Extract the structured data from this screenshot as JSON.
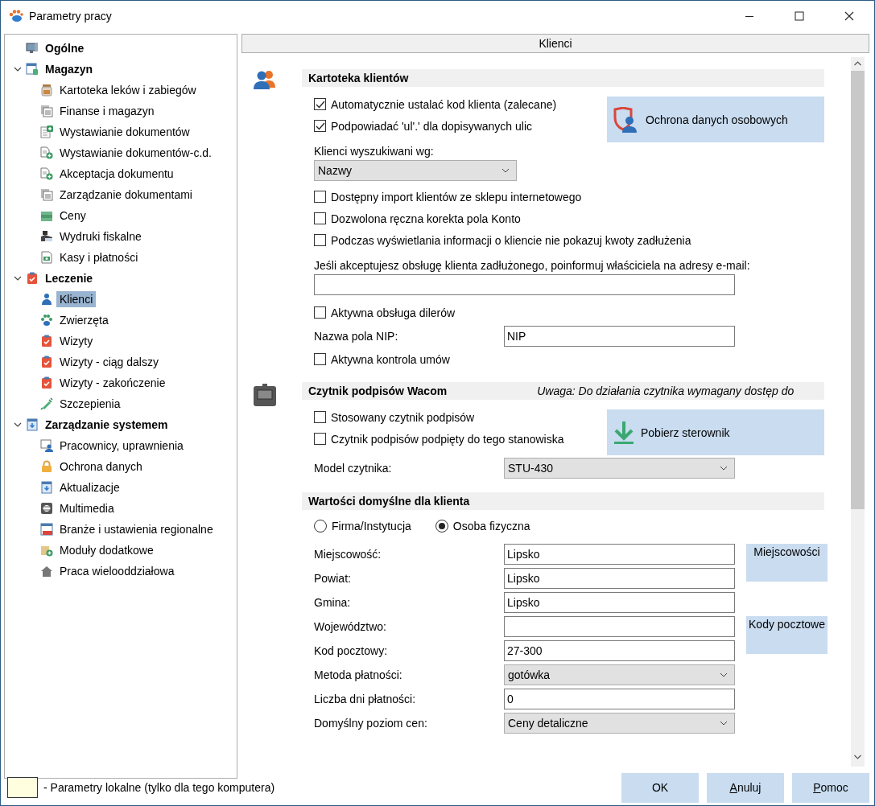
{
  "window": {
    "title": "Parametry pracy"
  },
  "tree": [
    {
      "label": "Ogólne",
      "kind": "monitor",
      "selected": false
    },
    {
      "label": "Magazyn",
      "kind": "form",
      "expanded": true,
      "selected": false,
      "children": [
        {
          "label": "Kartoteka leków i zabiegów",
          "kind": "jar",
          "selected": false
        },
        {
          "label": "Finanse i magazyn",
          "kind": "docs",
          "selected": false
        },
        {
          "label": "Wystawianie dokumentów",
          "kind": "doc-plus",
          "selected": false
        },
        {
          "label": "Wystawianie dokumentów-c.d.",
          "kind": "doc-add",
          "selected": false
        },
        {
          "label": "Akceptacja dokumentu",
          "kind": "doc-add",
          "selected": false
        },
        {
          "label": "Zarządzanie dokumentami",
          "kind": "docs",
          "selected": false
        },
        {
          "label": "Ceny",
          "kind": "money",
          "selected": false
        },
        {
          "label": "Wydruki fiskalne",
          "kind": "printer",
          "selected": false
        },
        {
          "label": "Kasy i płatności",
          "kind": "cash",
          "selected": false
        }
      ]
    },
    {
      "label": "Leczenie",
      "kind": "clipboard",
      "expanded": true,
      "selected": false,
      "children": [
        {
          "label": "Klienci",
          "kind": "person",
          "selected": true
        },
        {
          "label": "Zwierzęta",
          "kind": "paw",
          "selected": false
        },
        {
          "label": "Wizyty",
          "kind": "clipboard",
          "selected": false
        },
        {
          "label": "Wizyty - ciąg dalszy",
          "kind": "clipboard",
          "selected": false
        },
        {
          "label": "Wizyty - zakończenie",
          "kind": "clipboard",
          "selected": false
        },
        {
          "label": "Szczepienia",
          "kind": "syringe",
          "selected": false
        }
      ]
    },
    {
      "label": "Zarządzanie systemem",
      "kind": "update",
      "expanded": true,
      "selected": false,
      "children": [
        {
          "label": "Pracownicy, uprawnienia",
          "kind": "person-card",
          "selected": false
        },
        {
          "label": "Ochrona danych",
          "kind": "lock",
          "selected": false
        },
        {
          "label": "Aktualizacje",
          "kind": "update",
          "selected": false
        },
        {
          "label": "Multimedia",
          "kind": "film",
          "selected": false
        },
        {
          "label": "Branże i ustawienia regionalne",
          "kind": "window",
          "selected": false
        },
        {
          "label": "Moduły dodatkowe",
          "kind": "box-plus",
          "selected": false
        },
        {
          "label": "Praca wielooddziałowa",
          "kind": "house",
          "selected": false
        }
      ]
    }
  ],
  "page_title": "Klienci",
  "sections": [
    {
      "title": "Kartoteka klientów",
      "kind": "people",
      "side_button": {
        "label": "Ochrona danych osobowych",
        "kind": "shield-person"
      },
      "items": [
        {
          "kind": "checkbox",
          "label": "Automatycznie ustalać kod klienta (zalecane)",
          "checked": true
        },
        {
          "kind": "checkbox",
          "label": "Podpowiadać 'ul'.' dla dopisywanych ulic",
          "checked": true
        },
        {
          "kind": "label",
          "text": "Klienci wyszukiwani wg:"
        },
        {
          "kind": "select",
          "value": "Nazwy"
        },
        {
          "kind": "checkbox",
          "label": "Dostępny import klientów ze sklepu internetowego",
          "checked": false
        },
        {
          "kind": "checkbox",
          "label": "Dozwolona ręczna korekta pola Konto",
          "checked": false
        },
        {
          "kind": "checkbox",
          "label": "Podczas wyświetlania informacji o kliencie nie pokazuj kwoty zadłużenia",
          "checked": false
        },
        {
          "kind": "label",
          "text": "Jeśli akceptujesz obsługę klienta zadłużonego, poinformuj właściciela na adresy e-mail:"
        },
        {
          "kind": "input"
        },
        {
          "kind": "checkbox",
          "label": "Aktywna obsługa dilerów",
          "checked": false
        },
        {
          "kind": "field-input",
          "label": "Nazwa pola NIP:",
          "value": "NIP"
        },
        {
          "kind": "checkbox",
          "label": "Aktywna kontrola umów",
          "checked": false
        }
      ]
    },
    {
      "title": "Czytnik podpisów Wacom",
      "note": "Uwaga: Do działania czytnika wymagany dostęp do",
      "kind": "tablet",
      "side_button": {
        "label": "Pobierz sterownik",
        "kind": "download"
      },
      "items": [
        {
          "kind": "checkbox",
          "label": "Stosowany czytnik podpisów",
          "checked": false
        },
        {
          "kind": "checkbox",
          "label": "Czytnik podpisów podpięty do tego stanowiska",
          "checked": false
        },
        {
          "kind": "field-dropdown",
          "label": "Model czytnika:",
          "value": "STU-430"
        }
      ]
    },
    {
      "title": "Wartości domyślne dla klienta",
      "radios": [
        {
          "label": "Firma/Instytucja",
          "selected": false
        },
        {
          "label": "Osoba fizyczna",
          "selected": true
        }
      ],
      "rows": [
        {
          "label": "Miejscowość:",
          "value": "Lipsko",
          "kind": "input",
          "side_button": "Miejscowości"
        },
        {
          "label": "Powiat:",
          "value": "Lipsko",
          "kind": "input"
        },
        {
          "label": "Gmina:",
          "value": "Lipsko",
          "kind": "input"
        },
        {
          "label": "Województwo:",
          "kind": "input",
          "side_button": "Kody pocztowe"
        },
        {
          "label": "Kod pocztowy:",
          "value": "27-300",
          "kind": "input"
        },
        {
          "label": "Metoda płatności:",
          "value": "gotówka",
          "kind": "dropdown"
        },
        {
          "label": "Liczba dni płatności:",
          "value": "0",
          "kind": "input"
        },
        {
          "label": "Domyślny poziom cen:",
          "value": "Ceny detaliczne",
          "kind": "dropdown"
        }
      ]
    }
  ],
  "legend": {
    "text": "- Parametry lokalne (tylko dla tego komputera)"
  },
  "buttons": [
    {
      "label": "OK",
      "mnemonic": false
    },
    {
      "label": "Anuluj",
      "mnemonic": true
    },
    {
      "label": "Pomoc",
      "mnemonic": true
    }
  ]
}
